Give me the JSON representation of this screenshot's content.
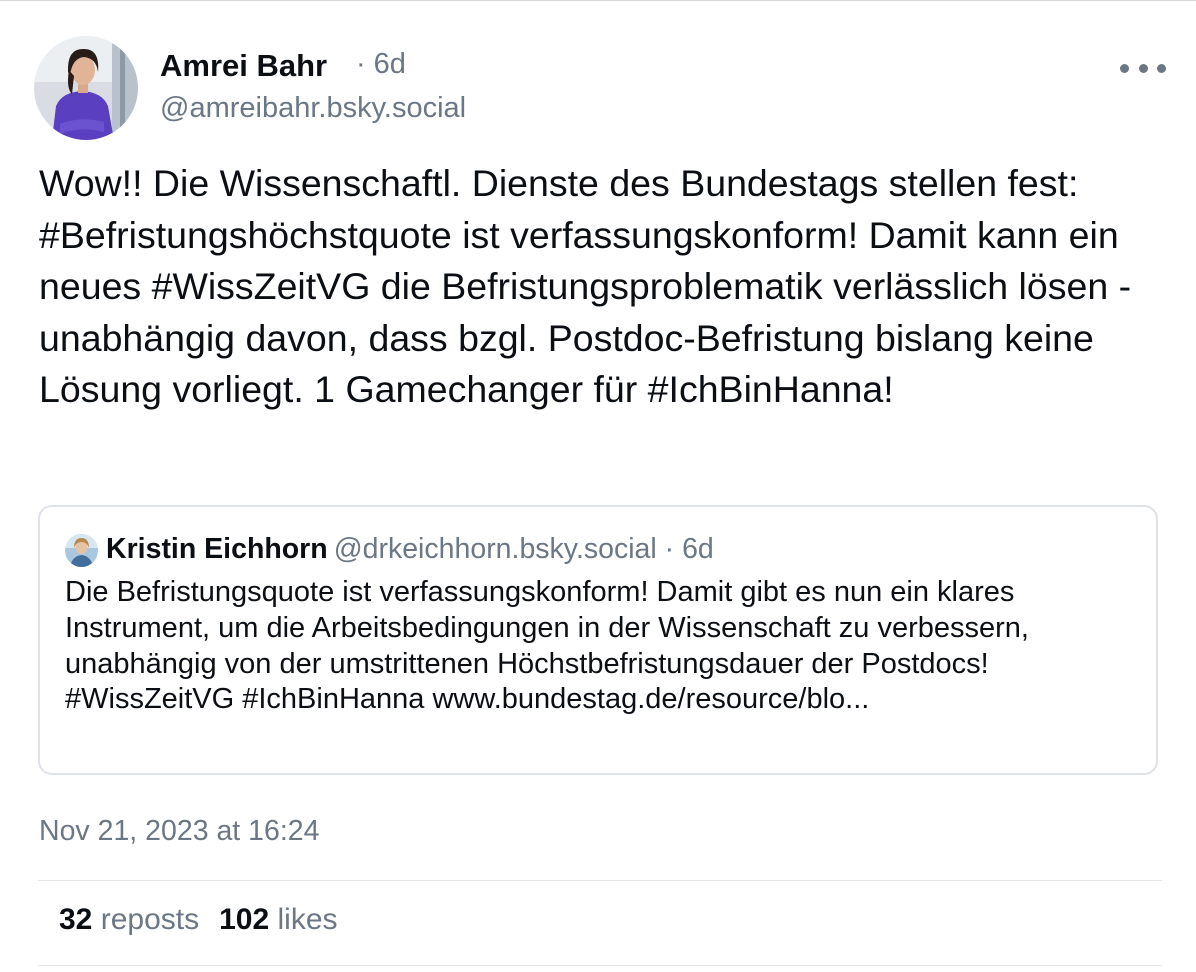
{
  "post": {
    "author_name": "Amrei Bahr",
    "time_ago": "6d",
    "handle": "@amreibahr.bsky.social",
    "text": "Wow!! Die Wissenschaftl. Dienste des Bundestags stellen fest: #Befristungshöchstquote ist verfassungskonform! Damit kann ein neues #WissZeitVG die Befristungsproblematik verlässlich lösen - unabhängig davon, dass bzgl. Postdoc-Befristung bislang keine Lösung vorliegt. 1 Gamechanger für #IchBinHanna!",
    "timestamp": "Nov 21, 2023 at 16:24",
    "more_icon": "ellipsis-horizontal-icon"
  },
  "quote": {
    "author_name": "Kristin Eichhorn",
    "handle": "@drkeichhorn.bsky.social",
    "time_ago": "6d",
    "text": "Die Befristungsquote ist verfassungskonform! Damit gibt es nun ein klares Instrument, um die Arbeitsbedingungen in der Wissenschaft zu verbessern, unabhängig von der umstrittenen Höchstbefristungsdauer der Postdocs! #WissZeitVG #IchBinHanna www.bundestag.de/resource/blo..."
  },
  "stats": {
    "reposts_count": "32",
    "reposts_label": "reposts",
    "likes_count": "102",
    "likes_label": "likes"
  },
  "colors": {
    "text_primary": "#0b0f14",
    "text_secondary": "#6b7785",
    "border": "#dfe3e8"
  }
}
